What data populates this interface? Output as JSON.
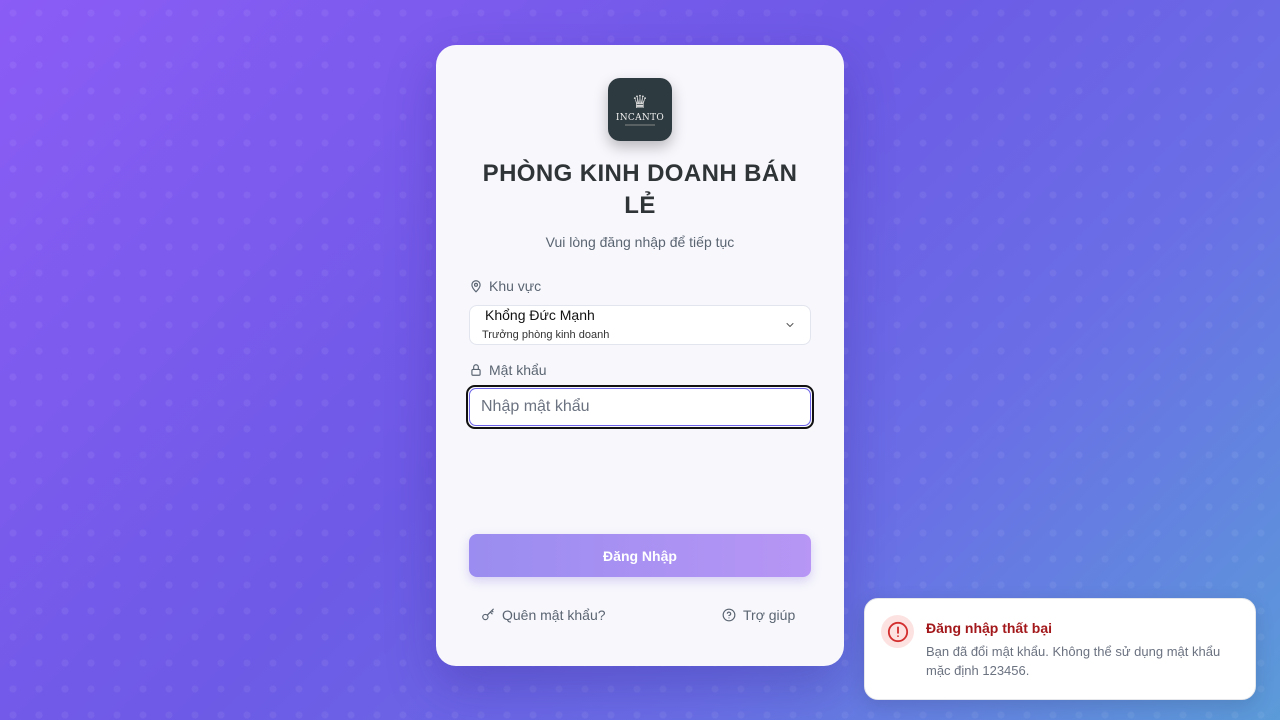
{
  "logo": {
    "brand": "INCANTO",
    "crest": "♛"
  },
  "login": {
    "title": "PHÒNG KINH DOANH BÁN LẺ",
    "subtitle": "Vui lòng đăng nhập để tiếp tục",
    "area_label": "Khu vực",
    "selected_user": {
      "name": "Khổng Đức Mạnh",
      "role": "Trưởng phòng kinh doanh"
    },
    "password_label": "Mật khẩu",
    "password_placeholder": "Nhập mật khẩu",
    "password_value": "",
    "submit_label": "Đăng Nhập",
    "forgot_label": "Quên mật khẩu?",
    "help_label": "Trợ giúp"
  },
  "toast": {
    "type": "error",
    "title": "Đăng nhập thất bại",
    "message": "Bạn đã đổi mật khẩu. Không thể sử dụng mật khẩu mặc định 123456."
  },
  "colors": {
    "accent": "#6d63e8",
    "button_start": "#9a8cf0",
    "button_end": "#b796f5",
    "error": "#a3181b"
  }
}
